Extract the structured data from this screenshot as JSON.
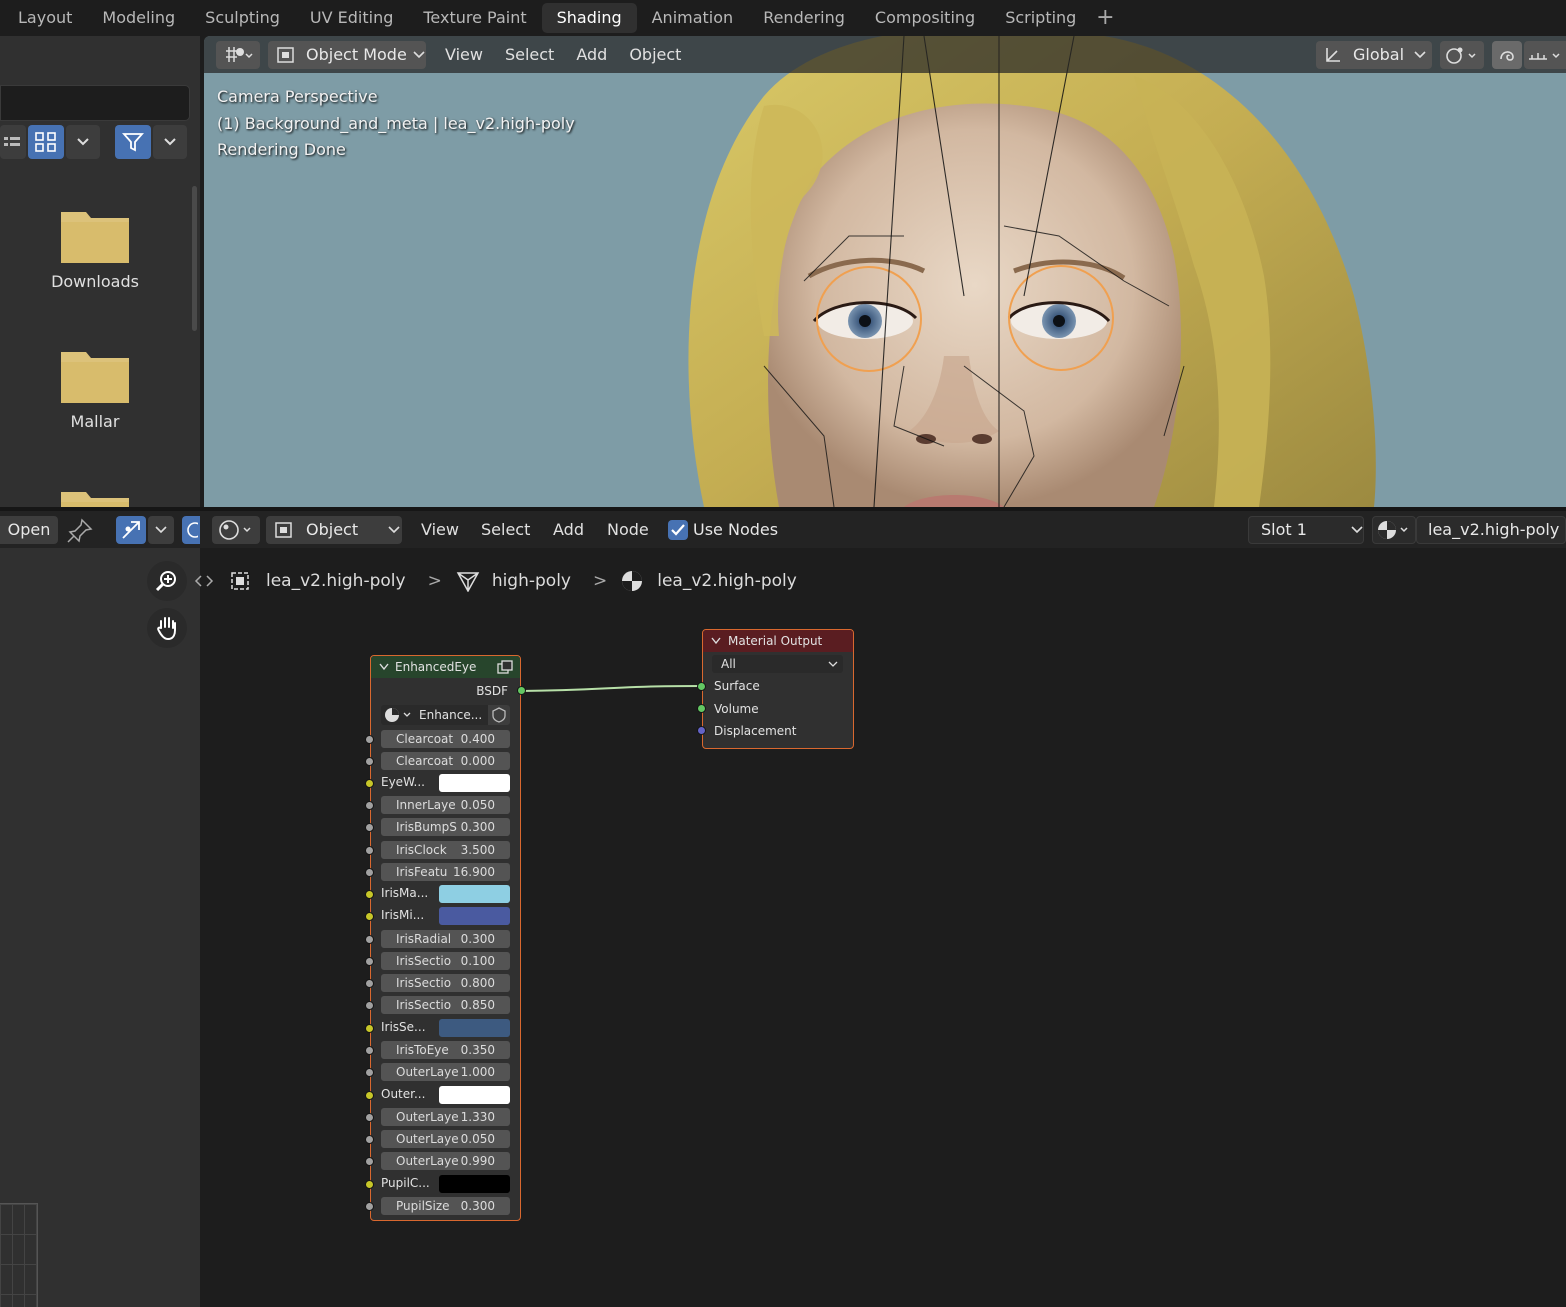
{
  "workspace_tabs": [
    "Layout",
    "Modeling",
    "Sculpting",
    "UV Editing",
    "Texture Paint",
    "Shading",
    "Animation",
    "Rendering",
    "Compositing",
    "Scripting"
  ],
  "workspace_add": "+",
  "file_browser": {
    "folders": [
      {
        "label": "Downloads"
      },
      {
        "label": "Mallar"
      }
    ]
  },
  "viewport": {
    "mode": "Object Mode",
    "menus": [
      "View",
      "Select",
      "Add",
      "Object"
    ],
    "transform_orientation": "Global",
    "info_lines": [
      "Camera Perspective",
      "(1) Background_and_meta | lea_v2.high-poly",
      "Rendering Done"
    ]
  },
  "node_editor": {
    "open_label": "Open",
    "object_type": "Object",
    "menus": [
      "View",
      "Select",
      "Add",
      "Node"
    ],
    "use_nodes_label": "Use Nodes",
    "slot": "Slot 1",
    "material_name": "lea_v2.high-poly",
    "breadcrumb": [
      "lea_v2.high-poly",
      "high-poly",
      "lea_v2.high-poly"
    ],
    "breadcrumb_sep": ">"
  },
  "node_enhanced_eye": {
    "title": "EnhancedEye",
    "output": "BSDF",
    "group": "Enhance...",
    "inputs": [
      {
        "name": "Clearcoat",
        "value": "0.400"
      },
      {
        "name": "Clearcoat",
        "value": "0.000"
      },
      {
        "name": "EyeW...",
        "color": "#ffffff"
      },
      {
        "name": "InnerLaye",
        "value": "0.050"
      },
      {
        "name": "IrisBumpS",
        "value": "0.300"
      },
      {
        "name": "IrisClock",
        "value": "3.500"
      },
      {
        "name": "IrisFeatu",
        "value": "16.900"
      },
      {
        "name": "IrisMa...",
        "color": "#8ecfe3"
      },
      {
        "name": "IrisMi...",
        "color": "#4a5aa0"
      },
      {
        "name": "IrisRadial",
        "value": "0.300"
      },
      {
        "name": "IrisSectio",
        "value": "0.100"
      },
      {
        "name": "IrisSectio",
        "value": "0.800"
      },
      {
        "name": "IrisSectio",
        "value": "0.850"
      },
      {
        "name": "IrisSe...",
        "color": "#3d5a80"
      },
      {
        "name": "IrisToEye",
        "value": "0.350"
      },
      {
        "name": "OuterLaye",
        "value": "1.000"
      },
      {
        "name": "Outer...",
        "color": "#ffffff"
      },
      {
        "name": "OuterLaye",
        "value": "1.330"
      },
      {
        "name": "OuterLaye",
        "value": "0.050"
      },
      {
        "name": "OuterLaye",
        "value": "0.990"
      },
      {
        "name": "PupilC...",
        "color": "#000000"
      },
      {
        "name": "PupilSize",
        "value": "0.300"
      }
    ]
  },
  "node_material_output": {
    "title": "Material Output",
    "target": "All",
    "inputs": [
      "Surface",
      "Volume",
      "Displacement"
    ]
  },
  "colors": {
    "accent": "#4772b3",
    "node_outline": "#d9682f",
    "socket_float": "#a1a1a1",
    "socket_color": "#c7c729",
    "socket_shader": "#63c763",
    "socket_vector": "#6363c7",
    "eye_ring": "#f0a050"
  }
}
